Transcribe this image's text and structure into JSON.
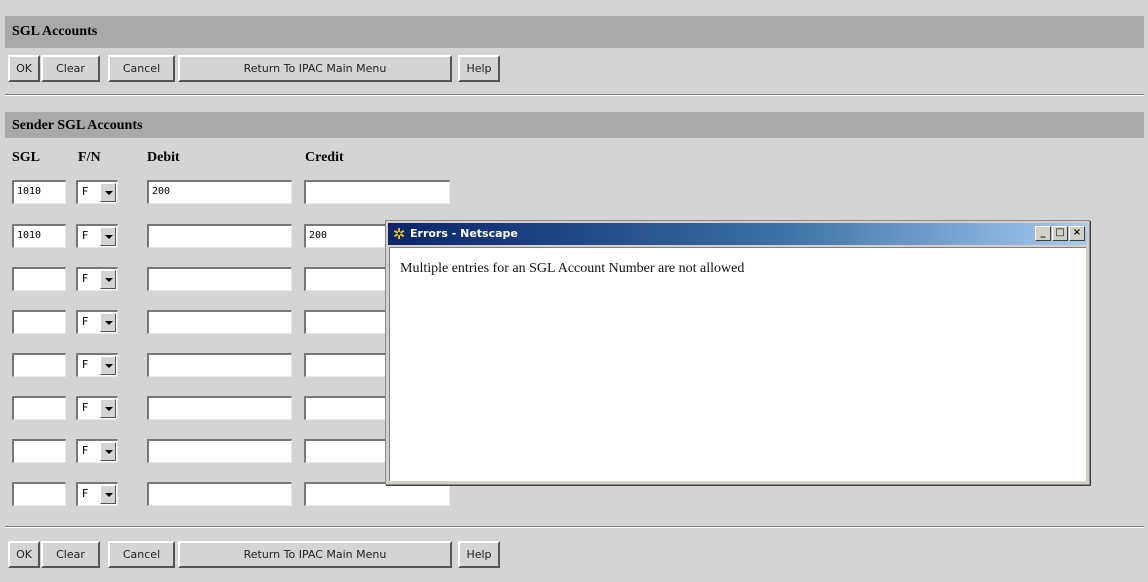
{
  "page": {
    "title": "SGL Accounts",
    "section_title": "Sender SGL Accounts"
  },
  "toolbar": {
    "ok": "OK",
    "clear": "Clear",
    "cancel": "Cancel",
    "return": "Return To IPAC Main Menu",
    "help": "Help"
  },
  "columns": {
    "sgl": "SGL",
    "fn": "F/N",
    "debit": "Debit",
    "credit": "Credit"
  },
  "rows": [
    {
      "sgl": "1010",
      "fn": "F",
      "debit": "200",
      "credit": ""
    },
    {
      "sgl": "1010",
      "fn": "F",
      "debit": "",
      "credit": "200"
    },
    {
      "sgl": "",
      "fn": "F",
      "debit": "",
      "credit": ""
    },
    {
      "sgl": "",
      "fn": "F",
      "debit": "",
      "credit": ""
    },
    {
      "sgl": "",
      "fn": "F",
      "debit": "",
      "credit": ""
    },
    {
      "sgl": "",
      "fn": "F",
      "debit": "",
      "credit": ""
    },
    {
      "sgl": "",
      "fn": "F",
      "debit": "",
      "credit": ""
    },
    {
      "sgl": "",
      "fn": "F",
      "debit": "",
      "credit": ""
    }
  ],
  "dialog": {
    "title": "Errors - Netscape",
    "message": "Multiple entries for an SGL Account Number are not allowed",
    "icon": "netscape-app-icon",
    "minimize_glyph": "_",
    "maximize_glyph": "□",
    "close_glyph": "×"
  },
  "colors": {
    "page_bg": "#d4d4d4",
    "band_bg": "#a9a9a9",
    "titlebar_start": "#0a246a",
    "titlebar_end": "#a6caf0"
  }
}
